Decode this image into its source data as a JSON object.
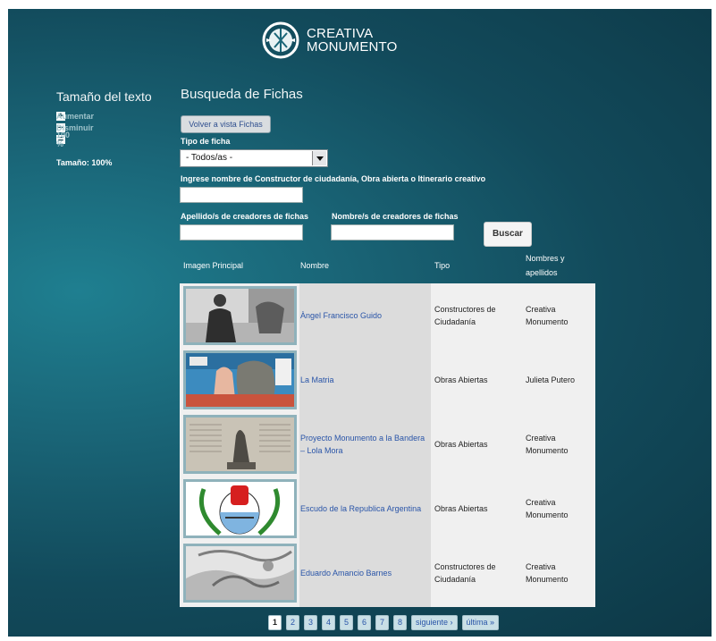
{
  "brand": {
    "line1": "CREATIVA",
    "line2": "MONUMENTO"
  },
  "sidebar": {
    "title": "Tamaño del texto",
    "increase": "Aumentar",
    "decrease": "Disminuir",
    "reset": "100 %",
    "current_size": "Tamaño: 100%"
  },
  "main": {
    "title": "Busqueda de Fichas",
    "back_button": "Volver a vista Fichas",
    "tipo_label": "Tipo de ficha",
    "tipo_value": "- Todos/as -",
    "name_label": "Ingrese nombre de Constructor de ciudadanía, Obra abierta o Itinerario creativo",
    "apellido_label": "Apellido/s de creadores de fichas",
    "nombre_label": "Nombre/s de creadores de fichas",
    "search_button": "Buscar"
  },
  "table": {
    "headers": {
      "image": "Imagen Principal",
      "name": "Nombre",
      "type": "Tipo",
      "authors_1": "Nombres y",
      "authors_2": "apellidos"
    },
    "rows": [
      {
        "name": "Àngel Francisco Guido",
        "type": "Constructores de Ciudadanía",
        "authors": "Creativa Monumento"
      },
      {
        "name": "La Matria",
        "type": "Obras Abiertas",
        "authors": "Julieta Putero"
      },
      {
        "name": "Proyecto Monumento a la Bandera – Lola Mora",
        "type": "Obras Abiertas",
        "authors": "Creativa Monumento"
      },
      {
        "name": "Escudo de la Republica Argentina",
        "type": "Obras Abiertas",
        "authors": "Creativa Monumento"
      },
      {
        "name": "Eduardo Amancio Barnes",
        "type": "Constructores de Ciudadanía",
        "authors": "Creativa Monumento"
      }
    ]
  },
  "pagination": {
    "pages": [
      "1",
      "2",
      "3",
      "4",
      "5",
      "6",
      "7",
      "8"
    ],
    "current": "1",
    "next": "siguiente ›",
    "last": "última »"
  }
}
